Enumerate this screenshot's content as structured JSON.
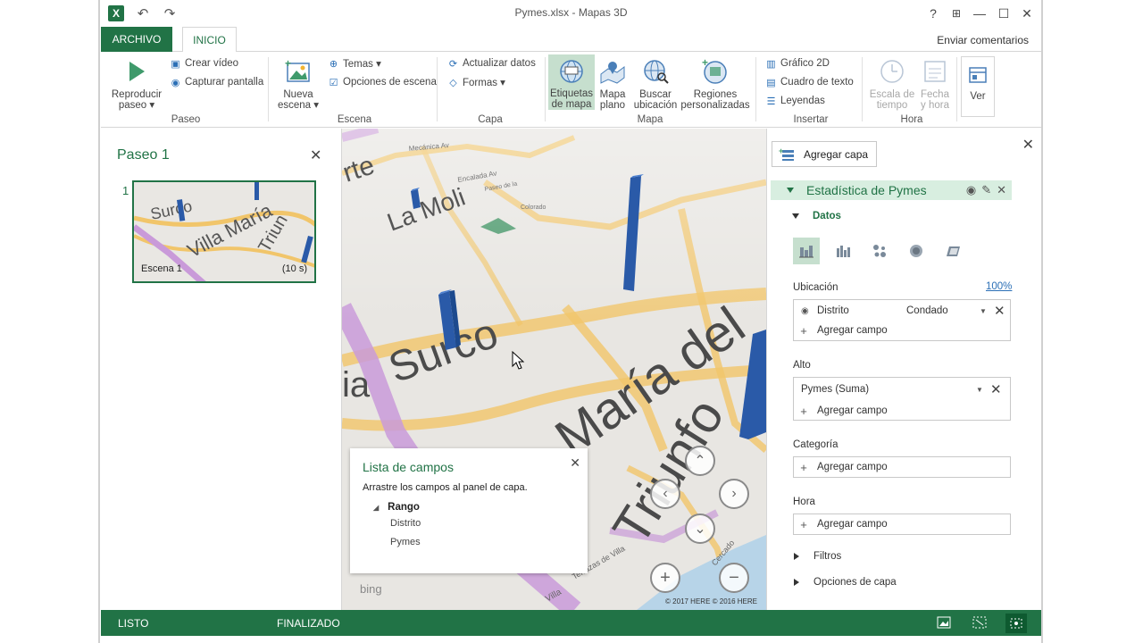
{
  "window": {
    "title": "Pymes.xlsx - Mapas 3D",
    "help": "?",
    "restore_glyph": "⊞",
    "minimize_glyph": "—",
    "maximize_glyph": "☐",
    "close_glyph": "✕"
  },
  "tabs": {
    "archivo": "ARCHIVO",
    "inicio": "INICIO",
    "feedback": "Enviar comentarios"
  },
  "ribbon": {
    "paseo": {
      "label": "Paseo",
      "play_line1": "Reproducir",
      "play_line2": "paseo ▾",
      "create_video": "Crear vídeo",
      "capture_screen": "Capturar pantalla"
    },
    "escena": {
      "label": "Escena",
      "new_line1": "Nueva",
      "new_line2": "escena ▾",
      "themes": "Temas ▾",
      "scene_options": "Opciones de escena"
    },
    "capa": {
      "label": "Capa",
      "refresh": "Actualizar datos",
      "shapes": "Formas ▾"
    },
    "mapa": {
      "label": "Mapa",
      "labels_line1": "Etiquetas",
      "labels_line2": "de mapa",
      "flat_line1": "Mapa",
      "flat_line2": "plano",
      "find_line1": "Buscar",
      "find_line2": "ubicación",
      "regions_line1": "Regiones",
      "regions_line2": "personalizadas"
    },
    "insertar": {
      "label": "Insertar",
      "chart2d": "Gráfico 2D",
      "textbox": "Cuadro de texto",
      "legends": "Leyendas"
    },
    "hora": {
      "label": "Hora",
      "timescale_line1": "Escala de",
      "timescale_line2": "tiempo",
      "datetime_line1": "Fecha",
      "datetime_line2": "y hora"
    },
    "ver": {
      "label": "Ver"
    }
  },
  "tour": {
    "title": "Paseo 1",
    "close_glyph": "✕",
    "scene_number": "1",
    "scene_name": "Escena 1",
    "scene_duration": "(10 s)"
  },
  "map": {
    "labels": {
      "surco": "Surco",
      "villa_maria": "Villa María del",
      "triunfo": "Triunfo",
      "la_molina": "La Moli",
      "villa": "Villa",
      "cercado": "Cercado",
      "terrazas": "Terrazas de Villa"
    },
    "attribution": "© 2017 HERE  © 2016 HERE",
    "bing": "bing",
    "nav": {
      "up": "⌃",
      "down": "⌄",
      "left": "‹",
      "right": "›",
      "zoom_in": "+",
      "zoom_out": "−"
    }
  },
  "field_list": {
    "title": "Lista de campos",
    "close_glyph": "✕",
    "instructions": "Arrastre los campos al panel de capa.",
    "range": "Rango",
    "fields": [
      "Distrito",
      "Pymes"
    ]
  },
  "layer_pane": {
    "close_glyph": "✕",
    "add_layer": "Agregar capa",
    "layer_name": "Estadística de Pymes",
    "data_section": "Datos",
    "location_label": "Ubicación",
    "location_percent": "100%",
    "location_field": "Distrito",
    "location_type": "Condado",
    "add_field": "Agregar campo",
    "height_label": "Alto",
    "height_field": "Pymes (Suma)",
    "category_label": "Categoría",
    "time_label": "Hora",
    "filters": "Filtros",
    "layer_options": "Opciones de capa"
  },
  "status": {
    "ready": "LISTO",
    "finished": "FINALIZADO"
  },
  "colors": {
    "accent": "#217346",
    "selected_bg": "#c6dfce",
    "column_blue": "#2a5aa8"
  }
}
